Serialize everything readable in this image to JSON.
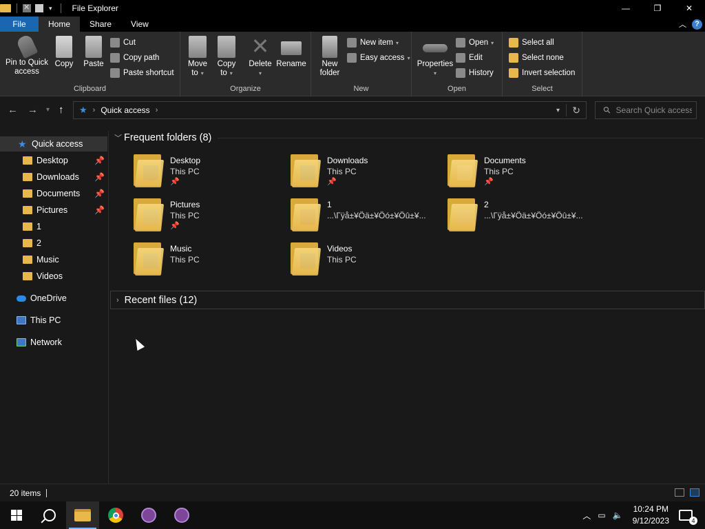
{
  "window": {
    "title": "File Explorer",
    "minimize": "—",
    "maximize": "❐",
    "close": "✕"
  },
  "tabs": {
    "file": "File",
    "home": "Home",
    "share": "Share",
    "view": "View"
  },
  "ribbon": {
    "clipboard": {
      "label": "Clipboard",
      "pin_line1": "Pin to Quick",
      "pin_line2": "access",
      "copy": "Copy",
      "paste": "Paste",
      "cut": "Cut",
      "copy_path": "Copy path",
      "paste_shortcut": "Paste shortcut"
    },
    "organize": {
      "label": "Organize",
      "move_line1": "Move",
      "move_line2": "to",
      "copy_line1": "Copy",
      "copy_line2": "to",
      "delete": "Delete",
      "rename": "Rename"
    },
    "new": {
      "label": "New",
      "new_folder_line1": "New",
      "new_folder_line2": "folder",
      "new_item": "New item",
      "easy_access": "Easy access"
    },
    "open": {
      "label": "Open",
      "properties": "Properties",
      "open": "Open",
      "edit": "Edit",
      "history": "History"
    },
    "select": {
      "label": "Select",
      "select_all": "Select all",
      "select_none": "Select none",
      "invert": "Invert selection"
    }
  },
  "address": {
    "crumb": "Quick access",
    "search_placeholder": "Search Quick access"
  },
  "nav": {
    "quick_access": "Quick access",
    "items": [
      {
        "label": "Desktop",
        "pinned": true
      },
      {
        "label": "Downloads",
        "pinned": true
      },
      {
        "label": "Documents",
        "pinned": true
      },
      {
        "label": "Pictures",
        "pinned": true
      },
      {
        "label": "1",
        "pinned": false
      },
      {
        "label": "2",
        "pinned": false
      },
      {
        "label": "Music",
        "pinned": false
      },
      {
        "label": "Videos",
        "pinned": false
      }
    ],
    "onedrive": "OneDrive",
    "this_pc": "This PC",
    "network": "Network"
  },
  "content": {
    "frequent_header": "Frequent folders (8)",
    "recent_header": "Recent files (12)",
    "folders": [
      {
        "name": "Desktop",
        "location": "This PC",
        "pinned": true,
        "badge": "#3f73b8"
      },
      {
        "name": "Downloads",
        "location": "This PC",
        "pinned": true,
        "badge": "#2a8ae8"
      },
      {
        "name": "Documents",
        "location": "This PC",
        "pinned": true,
        "badge": "#e9e9e9"
      },
      {
        "name": "Pictures",
        "location": "This PC",
        "pinned": true,
        "badge": "#6aa6d8"
      },
      {
        "name": "1",
        "location": "...\\Гÿå±¥Öä±¥Öó±¥Öû±¥...",
        "pinned": false,
        "badge": "#8a5c7a"
      },
      {
        "name": "2",
        "location": "...\\Гÿå±¥Öä±¥Öó±¥Öû±¥...",
        "pinned": false,
        "badge": "#c9a3b0"
      },
      {
        "name": "Music",
        "location": "This PC",
        "pinned": false,
        "badge": "#3d8ce6"
      },
      {
        "name": "Videos",
        "location": "This PC",
        "pinned": false,
        "badge": "#4b6fa0"
      }
    ]
  },
  "status": {
    "items_count": "20 items"
  },
  "taskbar": {
    "time": "10:24 PM",
    "date": "9/12/2023",
    "notifications": "4"
  },
  "colors": {
    "accent": "#1a66b0",
    "folder": "#e8b84a",
    "pin": "#7ab7ff",
    "background": "#191919",
    "ribbon": "#2b2b2b"
  }
}
